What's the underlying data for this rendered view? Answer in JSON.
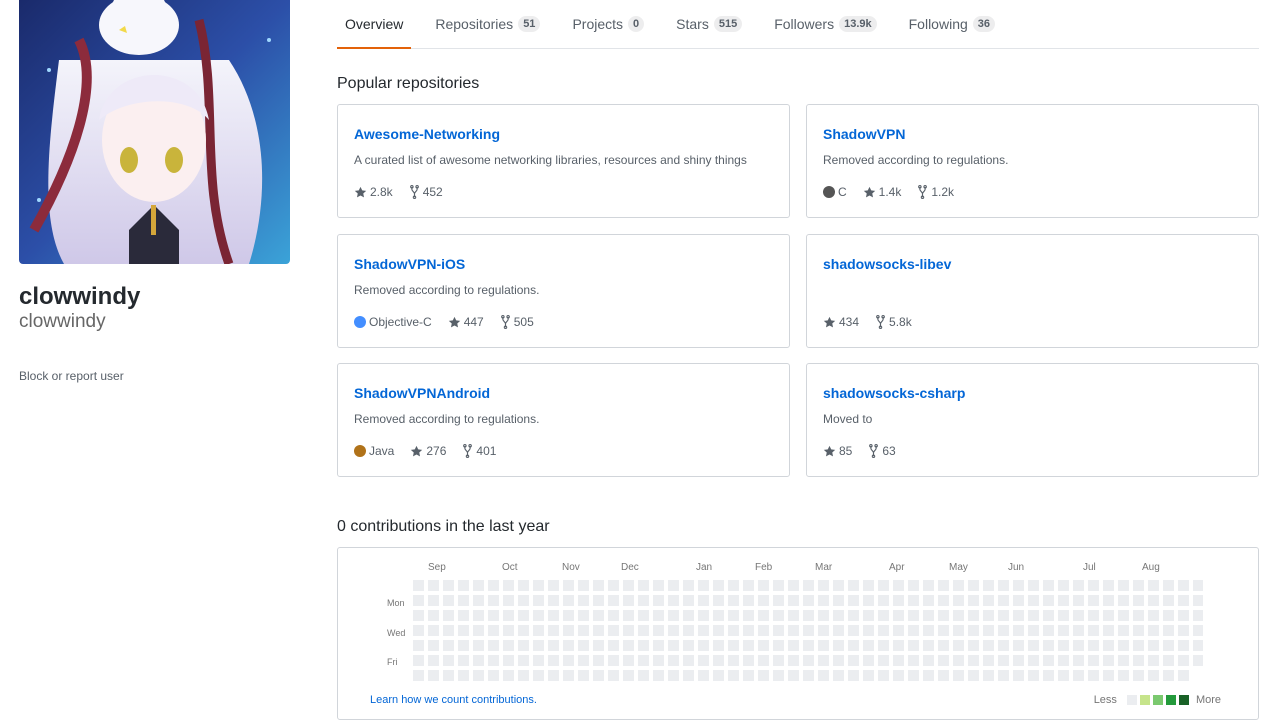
{
  "profile": {
    "name": "clowwindy",
    "login": "clowwindy",
    "block_link": "Block or report user"
  },
  "tabs": [
    {
      "label": "Overview",
      "count": null,
      "active": true
    },
    {
      "label": "Repositories",
      "count": "51"
    },
    {
      "label": "Projects",
      "count": "0"
    },
    {
      "label": "Stars",
      "count": "515"
    },
    {
      "label": "Followers",
      "count": "13.9k"
    },
    {
      "label": "Following",
      "count": "36"
    }
  ],
  "pinned": {
    "title": "Popular repositories",
    "repos": [
      {
        "name": "Awesome-Networking",
        "description": "A curated list of awesome networking libraries, resources and shiny things",
        "language": "",
        "language_color": "",
        "stars": "2.8k",
        "forks": "452"
      },
      {
        "name": "ShadowVPN",
        "description": "Removed according to regulations.",
        "language": "C",
        "language_color": "#555555",
        "stars": "1.4k",
        "forks": "1.2k"
      },
      {
        "name": "ShadowVPN-iOS",
        "description": "Removed according to regulations.",
        "language": "Objective-C",
        "language_color": "#438eff",
        "stars": "447",
        "forks": "505"
      },
      {
        "name": "shadowsocks-libev",
        "description": "",
        "language": "",
        "language_color": "",
        "stars": "434",
        "forks": "5.8k"
      },
      {
        "name": "ShadowVPNAndroid",
        "description": "Removed according to regulations.",
        "language": "Java",
        "language_color": "#b07219",
        "stars": "276",
        "forks": "401"
      },
      {
        "name": "shadowsocks-csharp",
        "description": "Moved to",
        "language": "",
        "language_color": "",
        "stars": "85",
        "forks": "63"
      }
    ]
  },
  "contributions": {
    "title": "0 contributions in the last year",
    "months": [
      "Sep",
      "Oct",
      "Nov",
      "Dec",
      "Jan",
      "Feb",
      "Mar",
      "Apr",
      "May",
      "Jun",
      "Jul",
      "Aug"
    ],
    "days": [
      "Mon",
      "Wed",
      "Fri"
    ],
    "learn_link": "Learn how we count contributions.",
    "legend_less": "Less",
    "legend_more": "More",
    "empty_color": "#ebedf0",
    "legend_colors": [
      "#ebedf0",
      "#c6e48b",
      "#7bc96f",
      "#239a3b",
      "#196127"
    ]
  },
  "icons": {
    "star": "star-icon",
    "fork": "fork-icon"
  },
  "colors": {
    "link": "#0366d6",
    "active_tab_underline": "#e36209"
  }
}
